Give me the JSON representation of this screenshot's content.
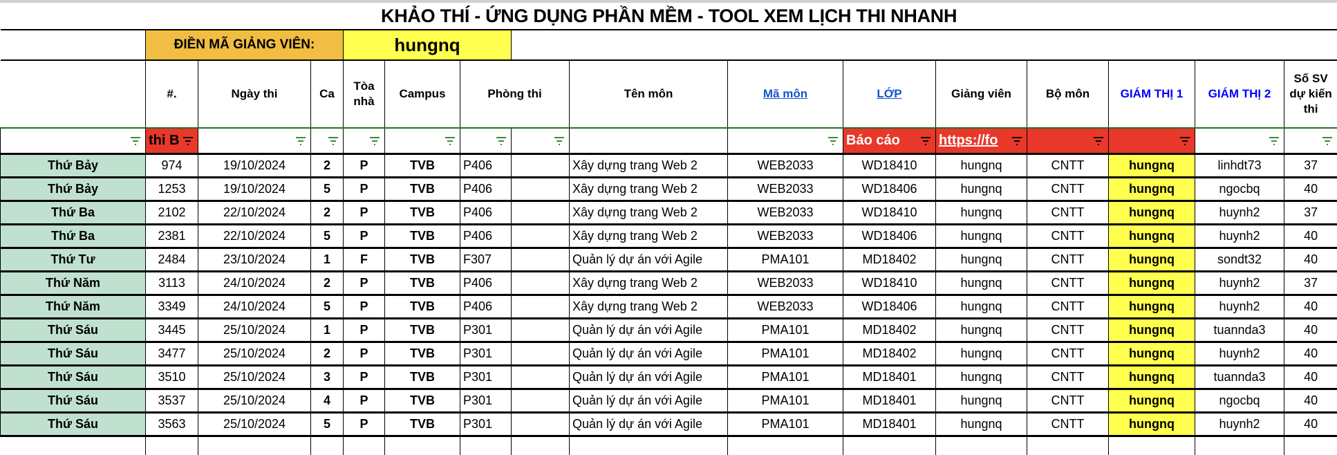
{
  "title": "KHẢO THÍ - ỨNG DỤNG PHẦN MỀM - TOOL XEM LỊCH THI NHANH",
  "input": {
    "label": "ĐIỀN MÃ GIẢNG VIÊN:",
    "value": "hungnq"
  },
  "headers": [
    "#.",
    "Ngày thi",
    "Ca",
    "Tòa nhà",
    "Campus",
    "Phòng thi",
    "Tên môn",
    "Mã môn",
    "LỚP",
    "Giảng viên",
    "Bộ môn",
    "GIÁM THỊ 1",
    "GIÁM THỊ 2",
    "Số SV dự kiến thi"
  ],
  "filters": {
    "col1": "thi B",
    "lop": "Báo cáo",
    "giang_vien": "https://fo"
  },
  "colors": {
    "day_bg": "#c0e1cf",
    "highlight": "#ffff4f",
    "label_bg": "#f1bd42",
    "filter_active": "#e8382a",
    "filter_icon": "#3a8a3a",
    "link": "#1155cc",
    "proctor_header": "#0000ff"
  },
  "rows": [
    [
      "Thứ Bảy",
      "974",
      "19/10/2024",
      "2",
      "P",
      "TVB",
      "P406",
      "Xây dựng trang Web 2",
      "WEB2033",
      "WD18410",
      "hungnq",
      "CNTT",
      "hungnq",
      "linhdt73",
      "37"
    ],
    [
      "Thứ Bảy",
      "1253",
      "19/10/2024",
      "5",
      "P",
      "TVB",
      "P406",
      "Xây dựng trang Web 2",
      "WEB2033",
      "WD18406",
      "hungnq",
      "CNTT",
      "hungnq",
      "ngocbq",
      "40"
    ],
    [
      "Thứ Ba",
      "2102",
      "22/10/2024",
      "2",
      "P",
      "TVB",
      "P406",
      "Xây dựng trang Web 2",
      "WEB2033",
      "WD18410",
      "hungnq",
      "CNTT",
      "hungnq",
      "huynh2",
      "37"
    ],
    [
      "Thứ Ba",
      "2381",
      "22/10/2024",
      "5",
      "P",
      "TVB",
      "P406",
      "Xây dựng trang Web 2",
      "WEB2033",
      "WD18406",
      "hungnq",
      "CNTT",
      "hungnq",
      "huynh2",
      "40"
    ],
    [
      "Thứ Tư",
      "2484",
      "23/10/2024",
      "1",
      "F",
      "TVB",
      "F307",
      "Quản lý dự án với Agile",
      "PMA101",
      "MD18402",
      "hungnq",
      "CNTT",
      "hungnq",
      "sondt32",
      "40"
    ],
    [
      "Thứ Năm",
      "3113",
      "24/10/2024",
      "2",
      "P",
      "TVB",
      "P406",
      "Xây dựng trang Web 2",
      "WEB2033",
      "WD18410",
      "hungnq",
      "CNTT",
      "hungnq",
      "huynh2",
      "37"
    ],
    [
      "Thứ Năm",
      "3349",
      "24/10/2024",
      "5",
      "P",
      "TVB",
      "P406",
      "Xây dựng trang Web 2",
      "WEB2033",
      "WD18406",
      "hungnq",
      "CNTT",
      "hungnq",
      "huynh2",
      "40"
    ],
    [
      "Thứ Sáu",
      "3445",
      "25/10/2024",
      "1",
      "P",
      "TVB",
      "P301",
      "Quản lý dự án với Agile",
      "PMA101",
      "MD18402",
      "hungnq",
      "CNTT",
      "hungnq",
      "tuannda3",
      "40"
    ],
    [
      "Thứ Sáu",
      "3477",
      "25/10/2024",
      "2",
      "P",
      "TVB",
      "P301",
      "Quản lý dự án với Agile",
      "PMA101",
      "MD18402",
      "hungnq",
      "CNTT",
      "hungnq",
      "huynh2",
      "40"
    ],
    [
      "Thứ Sáu",
      "3510",
      "25/10/2024",
      "3",
      "P",
      "TVB",
      "P301",
      "Quản lý dự án với Agile",
      "PMA101",
      "MD18401",
      "hungnq",
      "CNTT",
      "hungnq",
      "tuannda3",
      "40"
    ],
    [
      "Thứ Sáu",
      "3537",
      "25/10/2024",
      "4",
      "P",
      "TVB",
      "P301",
      "Quản lý dự án với Agile",
      "PMA101",
      "MD18401",
      "hungnq",
      "CNTT",
      "hungnq",
      "ngocbq",
      "40"
    ],
    [
      "Thứ Sáu",
      "3563",
      "25/10/2024",
      "5",
      "P",
      "TVB",
      "P301",
      "Quản lý dự án với Agile",
      "PMA101",
      "MD18401",
      "hungnq",
      "CNTT",
      "hungnq",
      "huynh2",
      "40"
    ]
  ]
}
